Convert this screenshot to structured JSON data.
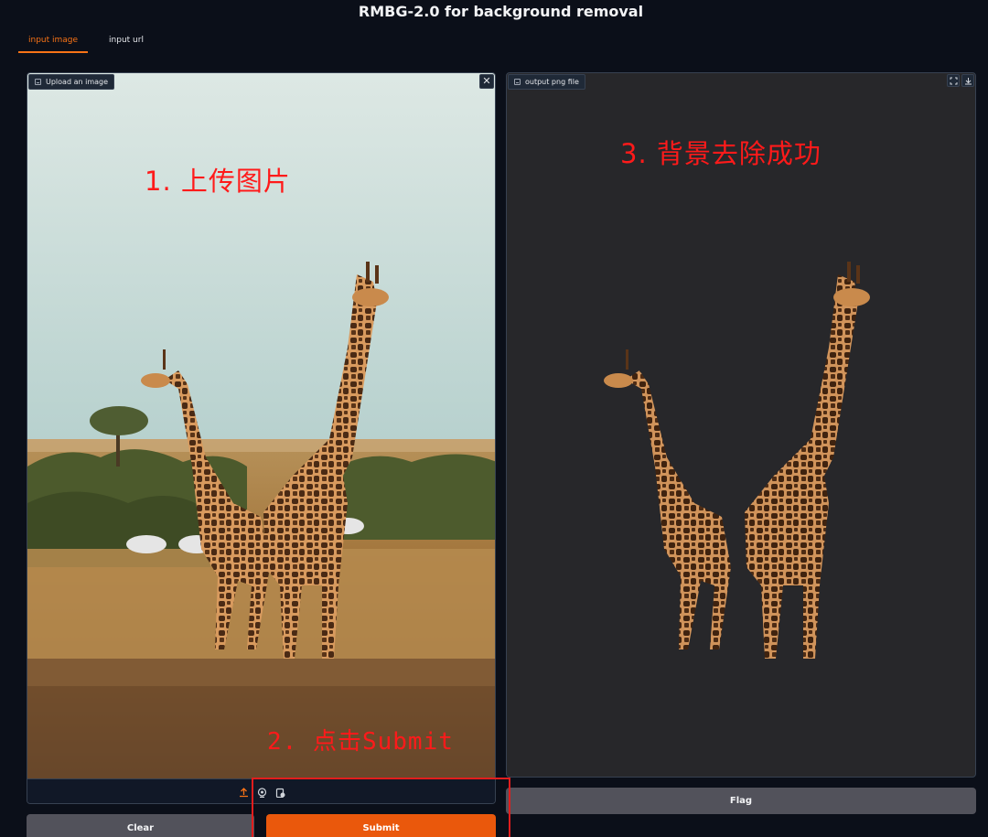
{
  "app": {
    "title": "RMBG-2.0 for background removal"
  },
  "tabs": [
    {
      "label": "input image",
      "active": true
    },
    {
      "label": "input url",
      "active": false
    }
  ],
  "input_panel": {
    "label": "Upload an image",
    "close_icon": "close-icon",
    "toolbar_icons": [
      "upload-icon",
      "webcam-icon",
      "clipboard-icon"
    ]
  },
  "output_panel": {
    "label": "output png file",
    "tool_icons": [
      "fullscreen-icon",
      "download-icon"
    ]
  },
  "annotations": {
    "step1": "1. 上传图片",
    "step2": "2. 点击Submit",
    "step3": "3. 背景去除成功"
  },
  "buttons": {
    "clear": "Clear",
    "submit": "Submit",
    "flag": "Flag"
  },
  "colors": {
    "accent": "#f97316",
    "submit_bg": "#ea580c",
    "annotation": "#ff1a1a"
  }
}
